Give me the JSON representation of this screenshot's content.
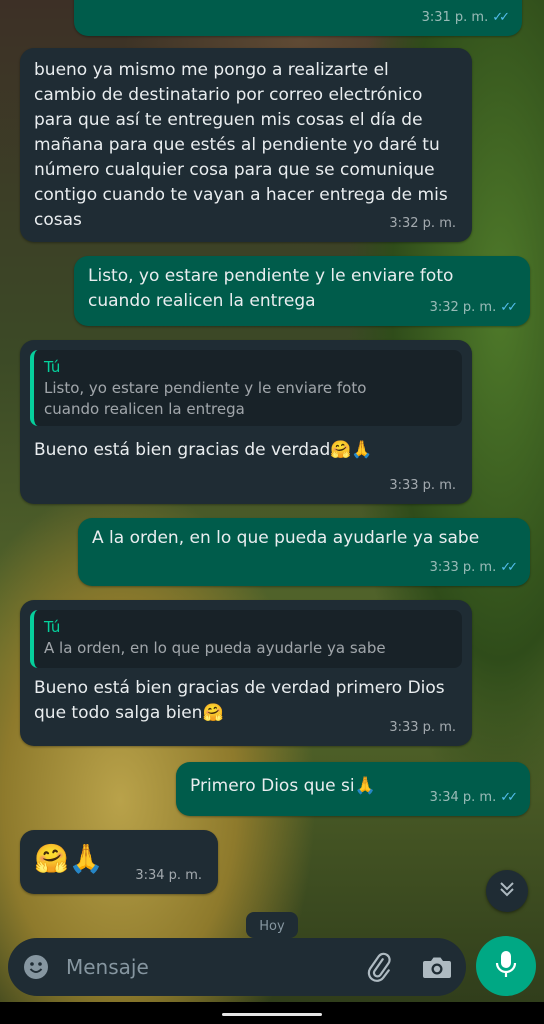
{
  "messages": [
    {
      "text": "",
      "time": "3:31 p. m.",
      "ticks": "✓✓"
    },
    {
      "text": "bueno ya mismo me pongo a realizarte el cambio de destinatario por correo electrónico para que así te entreguen mis cosas el día de mañana para que estés al pendiente yo daré tu número cualquier cosa para que se comunique contigo cuando te vayan a hacer entrega de mis cosas",
      "time": "3:32 p. m."
    },
    {
      "text": "Listo, yo estare pendiente y le enviare foto cuando realicen la entrega",
      "time": "3:32 p. m.",
      "ticks": "✓✓"
    },
    {
      "quote_author": "Tú",
      "quote_text": "Listo, yo estare pendiente y le enviare foto cuando realicen la entrega",
      "text": "Bueno está bien gracias de verdad🤗🙏",
      "time": "3:33 p. m."
    },
    {
      "text": "A la orden, en lo que pueda ayudarle ya sabe",
      "time": "3:33 p. m.",
      "ticks": "✓✓"
    },
    {
      "quote_author": "Tú",
      "quote_text": "A la orden, en lo que pueda ayudarle ya sabe",
      "text": "Bueno está bien gracias de verdad primero Dios que todo salga bien🤗",
      "time": "3:33 p. m."
    },
    {
      "text": "Primero Dios que si🙏",
      "time": "3:34 p. m.",
      "ticks": "✓✓"
    },
    {
      "text": "🤗🙏",
      "time": "3:34 p. m."
    }
  ],
  "date_chip": "Hoy",
  "composer": {
    "placeholder": "Mensaje"
  },
  "icons": {
    "emoji": "emoji-icon",
    "attach": "paperclip-icon",
    "camera": "camera-icon",
    "mic": "mic-icon",
    "scroll_down": "chevron-double-down-icon"
  },
  "colors": {
    "incoming_bubble": "#1f2c34",
    "outgoing_bubble": "#005c4b",
    "accent": "#00a884",
    "read_ticks": "#53bdeb"
  }
}
